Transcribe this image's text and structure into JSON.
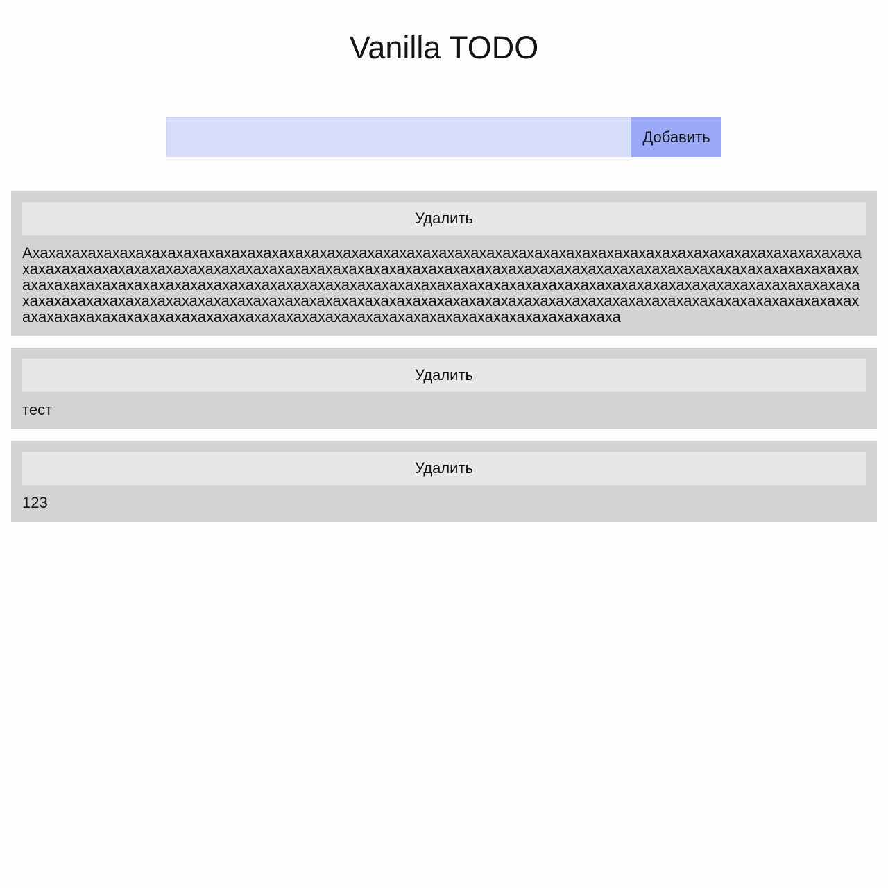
{
  "app": {
    "title": "Vanilla TODO"
  },
  "form": {
    "input_value": "",
    "input_placeholder": "",
    "add_label": "Добавить"
  },
  "todos": [
    {
      "delete_label": "Удалить",
      "text": "Ахахахахахахахахахахахахахахахахахахахахахахахахахахахахахахахахахахахахахахахахахахахахахахахахахахахахахахахахахахахахахахахахахахахахахахахахахахахахахахахахахахахахахахахахахахахахахахахахахахахахахахахахахахахахахахахахахахахахахахахахахахахахахахахахахахахахахахахахахахахахахахахахахахахахахахахахахахахахахахахахахахахахахахахахахахахахахахахахахахахахахахахахахахахахахахахахахахахахахахахахахахахахахахахахахахахахахахахахахахахахахахахахахахахахахахахахахахахахахахахахахахахахахахаха"
    },
    {
      "delete_label": "Удалить",
      "text": "тест"
    },
    {
      "delete_label": "Удалить",
      "text": "123"
    }
  ]
}
